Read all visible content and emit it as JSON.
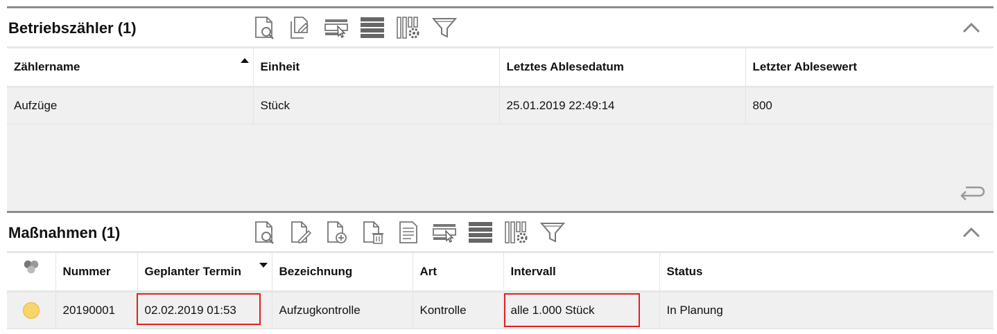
{
  "betrieb": {
    "title": "Betriebszähler (1)",
    "toolbar": [
      "view-details-icon",
      "copy-document-icon",
      "select-row-icon",
      "list-view-icon",
      "column-settings-icon",
      "filter-icon"
    ],
    "columns": [
      "Zählername",
      "Einheit",
      "Letztes Ablesedatum",
      "Letzter Ablesewert"
    ],
    "rows": [
      [
        "Aufzüge",
        "Stück",
        "25.01.2019 22:49:14",
        "800"
      ]
    ]
  },
  "massnahmen": {
    "title": "Maßnahmen (1)",
    "toolbar": [
      "view-details-icon",
      "edit-document-icon",
      "add-document-icon",
      "delete-document-icon",
      "report-document-icon",
      "select-row-icon",
      "list-view-icon",
      "column-settings-icon",
      "filter-icon"
    ],
    "columns": [
      "",
      "Nummer",
      "Geplanter Termin",
      "Bezeichnung",
      "Art",
      "Intervall",
      "Status"
    ],
    "rows": [
      {
        "status_color": "#f7d56a",
        "cells": [
          "20190001",
          "02.02.2019 01:53",
          "Aufzugkontrolle",
          "Kontrolle",
          "alle 1.000 Stück",
          "In Planung"
        ]
      }
    ]
  },
  "colors": {
    "highlight": "#e02020",
    "row_bg": "#f0f0f0",
    "border": "#8c8c8c"
  }
}
